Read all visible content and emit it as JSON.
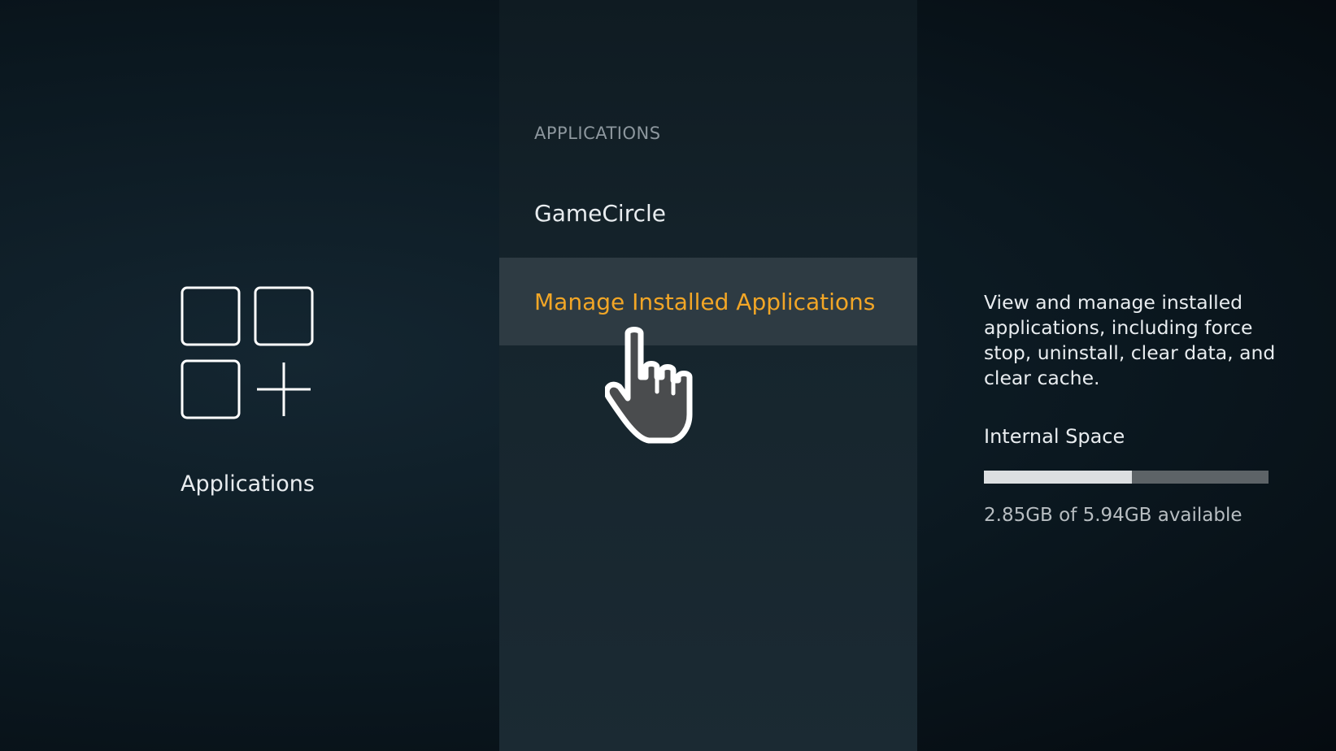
{
  "sidebar": {
    "icon": "apps-grid-plus-icon",
    "label": "Applications"
  },
  "menu": {
    "header": "APPLICATIONS",
    "items": [
      {
        "label": "GameCircle",
        "selected": false
      },
      {
        "label": "Manage Installed Applications",
        "selected": true
      }
    ]
  },
  "details": {
    "description": "View and manage installed applications, including force stop, uninstall, clear data, and clear cache.",
    "storage_title": "Internal Space",
    "storage_text": "2.85GB of 5.94GB available",
    "used_fraction": 0.52
  },
  "colors": {
    "selected_text": "#f2a626",
    "selected_bg": "#2e3b43"
  },
  "cursor": {
    "icon": "hand-pointer-icon"
  }
}
